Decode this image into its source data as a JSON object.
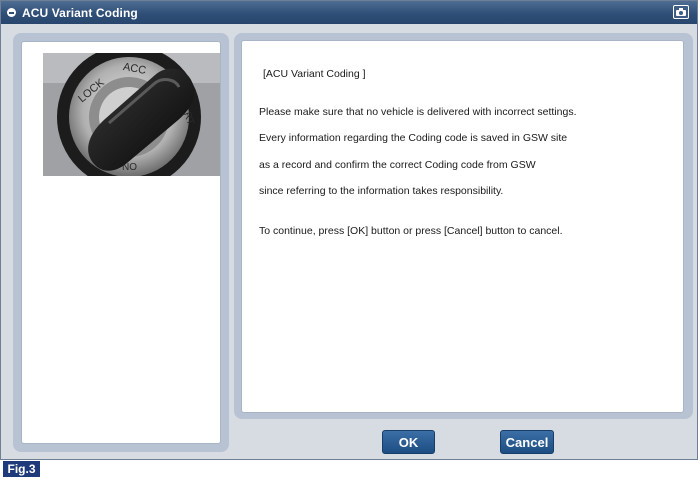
{
  "window": {
    "title": "ACU Variant Coding"
  },
  "icons": {
    "title_icon": "app-icon",
    "capture_icon": "camera-icon"
  },
  "message": {
    "heading": "[ACU Variant Coding ]",
    "line1": "Please make sure that no vehicle is delivered with incorrect settings.",
    "line2": "Every information regarding the Coding code is saved in GSW site",
    "line3": "as a record and confirm the correct Coding code from GSW",
    "line4": "since referring to the information takes responsibility.",
    "line5": "To continue, press [OK] button or press [Cancel] button to cancel."
  },
  "image_text": {
    "lock": "LOCK",
    "acc": "ACC",
    "start": "START",
    "on": "ON"
  },
  "buttons": {
    "ok": "OK",
    "cancel": "Cancel"
  },
  "figure": {
    "label": "Fig.3"
  },
  "colors": {
    "titlebar": "#2f4f78",
    "panel_border": "#b7c2d3",
    "button": "#1d4d83",
    "fig_label": "#1f3a7a"
  }
}
